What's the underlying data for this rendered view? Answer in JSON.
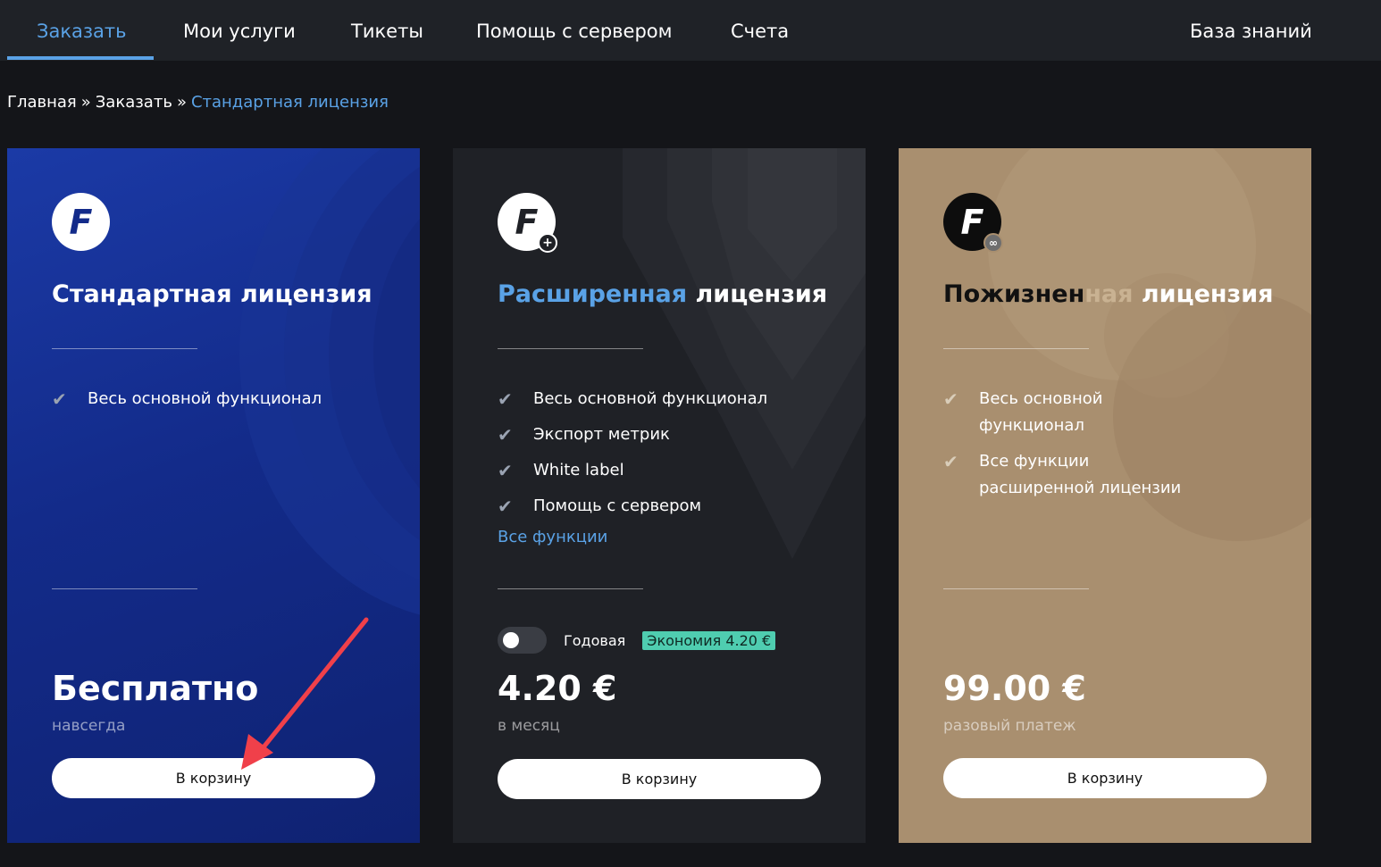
{
  "nav": {
    "items": [
      {
        "label": "Заказать",
        "active": true
      },
      {
        "label": "Мои услуги",
        "active": false
      },
      {
        "label": "Тикеты",
        "active": false
      },
      {
        "label": "Помощь с сервером",
        "active": false
      },
      {
        "label": "Счета",
        "active": false
      }
    ],
    "knowledge_base": "База знаний",
    "accent_color": "#5aa2e6"
  },
  "breadcrumb": {
    "home": "Главная",
    "separator": "»",
    "order": "Заказать",
    "current": "Стандартная лицензия"
  },
  "cards": [
    {
      "logo_letter": "F",
      "title_main": "Стандартная лицензия",
      "features": [
        "Весь основной функционал"
      ],
      "price": "Бесплатно",
      "price_note": "навсегда",
      "button": "В корзину",
      "background": "#132b8a"
    },
    {
      "logo_letter": "F",
      "logo_badge": "+",
      "title_highlight": "Расширенная",
      "title_rest": " лицензия",
      "features": [
        "Весь основной функционал",
        "Экспорт метрик",
        "White label",
        "Помощь с сервером"
      ],
      "all_features_link": "Все функции",
      "toggle_label": "Годовая",
      "toggle_on": false,
      "savings_badge": "Экономия 4.20 €",
      "price": "4.20 €",
      "price_note": "в месяц",
      "button": "В корзину",
      "background": "#1f2126",
      "badge_color": "#4fcdb0"
    },
    {
      "logo_letter": "F",
      "logo_badge": "∞",
      "title_dark": "Пожизнен",
      "title_highlight": "ная",
      "title_rest": " лицензия",
      "features": [
        "Весь основной функционал",
        "Все функции расширенной лицензии"
      ],
      "price": "99.00 €",
      "price_note": "разовый платеж",
      "button": "В корзину",
      "background": "#a98f6f"
    }
  ],
  "check_icon": "checkmark-icon",
  "annotation_arrow_color": "#f0404a"
}
